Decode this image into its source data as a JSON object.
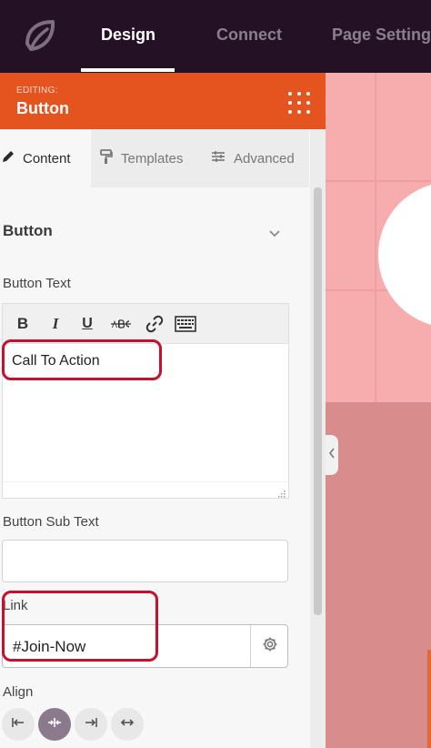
{
  "nav": {
    "tabs": [
      {
        "label": "Design",
        "active": true
      },
      {
        "label": "Connect",
        "active": false
      },
      {
        "label": "Page Settings",
        "active": false
      }
    ]
  },
  "editing": {
    "caption": "EDITING:",
    "title": "Button"
  },
  "panel_tabs": [
    {
      "label": "Content",
      "icon": "pencil-icon",
      "active": true
    },
    {
      "label": "Templates",
      "icon": "paint-roller-icon",
      "active": false
    },
    {
      "label": "Advanced",
      "icon": "sliders-icon",
      "active": false
    }
  ],
  "section": {
    "title": "Button"
  },
  "fields": {
    "button_text": {
      "label": "Button Text",
      "value": "Call To Action",
      "toolbar": [
        "bold-icon",
        "italic-icon",
        "underline-icon",
        "strikethrough-icon",
        "link-icon",
        "keyboard-icon"
      ]
    },
    "sub_text": {
      "label": "Button Sub Text",
      "value": ""
    },
    "link": {
      "label": "Link",
      "value": "#Join-Now"
    },
    "align": {
      "label": "Align",
      "options": [
        "align-left-icon",
        "align-center-icon",
        "align-right-icon",
        "align-full-icon"
      ],
      "selected": "align-center-icon"
    }
  },
  "colors": {
    "topbar": "#241126",
    "header": "#e5531e",
    "highlight": "#c8102e",
    "preview_tiles": "#f7adad",
    "preview_base": "#d98c8c"
  }
}
